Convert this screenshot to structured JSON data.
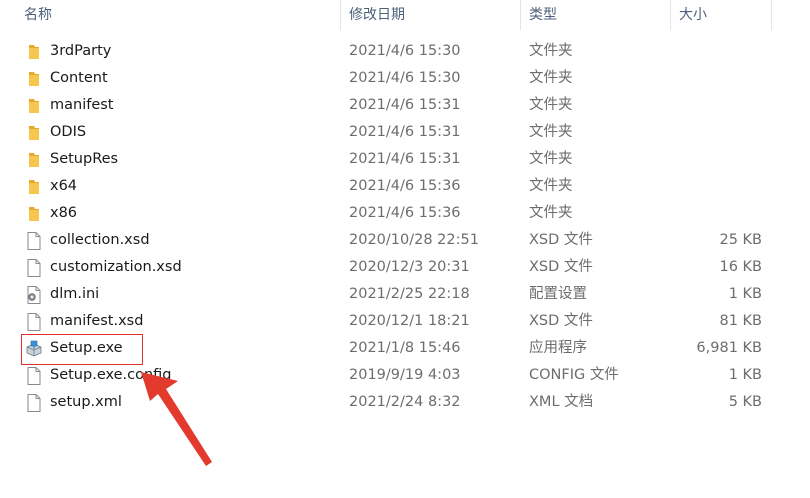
{
  "columns": {
    "name": "名称",
    "date": "修改日期",
    "type": "类型",
    "size": "大小"
  },
  "files": [
    {
      "name": "3rdParty",
      "date": "2021/4/6 15:30",
      "type": "文件夹",
      "size": "",
      "icon": "folder-icon"
    },
    {
      "name": "Content",
      "date": "2021/4/6 15:30",
      "type": "文件夹",
      "size": "",
      "icon": "folder-icon"
    },
    {
      "name": "manifest",
      "date": "2021/4/6 15:31",
      "type": "文件夹",
      "size": "",
      "icon": "folder-icon"
    },
    {
      "name": "ODIS",
      "date": "2021/4/6 15:31",
      "type": "文件夹",
      "size": "",
      "icon": "folder-icon"
    },
    {
      "name": "SetupRes",
      "date": "2021/4/6 15:31",
      "type": "文件夹",
      "size": "",
      "icon": "folder-icon"
    },
    {
      "name": "x64",
      "date": "2021/4/6 15:36",
      "type": "文件夹",
      "size": "",
      "icon": "folder-icon"
    },
    {
      "name": "x86",
      "date": "2021/4/6 15:36",
      "type": "文件夹",
      "size": "",
      "icon": "folder-icon"
    },
    {
      "name": "collection.xsd",
      "date": "2020/10/28 22:51",
      "type": "XSD 文件",
      "size": "25 KB",
      "icon": "file-icon"
    },
    {
      "name": "customization.xsd",
      "date": "2020/12/3 20:31",
      "type": "XSD 文件",
      "size": "16 KB",
      "icon": "file-icon"
    },
    {
      "name": "dlm.ini",
      "date": "2021/2/25 22:18",
      "type": "配置设置",
      "size": "1 KB",
      "icon": "settings-file-icon"
    },
    {
      "name": "manifest.xsd",
      "date": "2020/12/1 18:21",
      "type": "XSD 文件",
      "size": "81 KB",
      "icon": "file-icon"
    },
    {
      "name": "Setup.exe",
      "date": "2021/1/8 15:46",
      "type": "应用程序",
      "size": "6,981 KB",
      "icon": "setup-exe-icon"
    },
    {
      "name": "Setup.exe.config",
      "date": "2019/9/19 4:03",
      "type": "CONFIG 文件",
      "size": "1 KB",
      "icon": "file-icon"
    },
    {
      "name": "setup.xml",
      "date": "2021/2/24 8:32",
      "type": "XML 文档",
      "size": "5 KB",
      "icon": "file-icon"
    }
  ],
  "colors": {
    "highlight": "#e0302b",
    "arrow": "#e23b2e",
    "folder": "#f5c04a",
    "header_text": "#4c607a"
  }
}
